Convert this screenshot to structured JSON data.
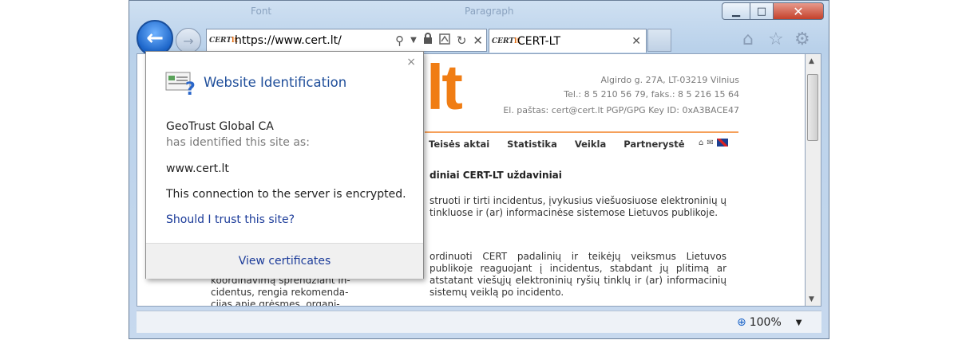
{
  "window": {
    "ghost_titles": [
      "Font",
      "Paragraph"
    ],
    "minimize_symbol": "▁",
    "maximize_symbol": "□",
    "close_symbol": "✕"
  },
  "toolbar": {
    "back_symbol": "←",
    "forward_symbol": "→"
  },
  "address": {
    "favicon_text": "CERT",
    "favicon_accent": "lt",
    "url": "https://www.cert.lt/",
    "icons": [
      "search-icon",
      "dropdown-icon",
      "lock-icon",
      "compat-icon",
      "refresh-icon",
      "stop-icon"
    ]
  },
  "tab": {
    "favicon_text": "CERT",
    "favicon_accent": "lt",
    "title": "CERT-LT",
    "close": "✕"
  },
  "page": {
    "logo_lt": "lt",
    "address_line": "Algirdo g. 27A, LT-03219 Vilnius",
    "phone_line": "Tel.: 8 5 210 56 79, faks.: 8 5 216 15 64",
    "email_line": "El. paštas:  cert@cert.lt  PGP/GPG Key ID: 0xA3BACE47",
    "nav": [
      "Teisės aktai",
      "Statistika",
      "Veikla",
      "Partnerystė"
    ],
    "heading": "diniai CERT-LT uždaviniai",
    "para1": "struoti ir tirti incidentus, įvykusius viešuosiuose elektroninių ų tinkluose ir (ar) informacinėse sistemose Lietuvos publikoje.",
    "para2": "ordinuoti CERT padalinių ir teikėjų veiksmus Lietuvos publikoje reaguojant į incidentus, stabdant jų plitimą ar atstatant viešųjų elektroninių ryšių tinklų ir (ar) informacinių sistemų veiklą po incidento.",
    "left_para": "koordinavimą sprendžiant in- cidentus, rengia rekomenda- cijas apie grėsmes, organi-"
  },
  "status": {
    "zoom": "100%"
  },
  "popup": {
    "title": "Website Identification",
    "ca": "GeoTrust Global CA",
    "identified": "has identified this site as:",
    "site": "www.cert.lt",
    "encrypted": "This connection to the server is encrypted.",
    "trust_link": "Should I trust this site?",
    "view_certs": "View certificates",
    "close": "×"
  },
  "colors": {
    "accent_orange": "#f07d14",
    "link_blue": "#1b3b99",
    "title_blue": "#1f4e9a",
    "back_blue": "#1b64c8"
  }
}
